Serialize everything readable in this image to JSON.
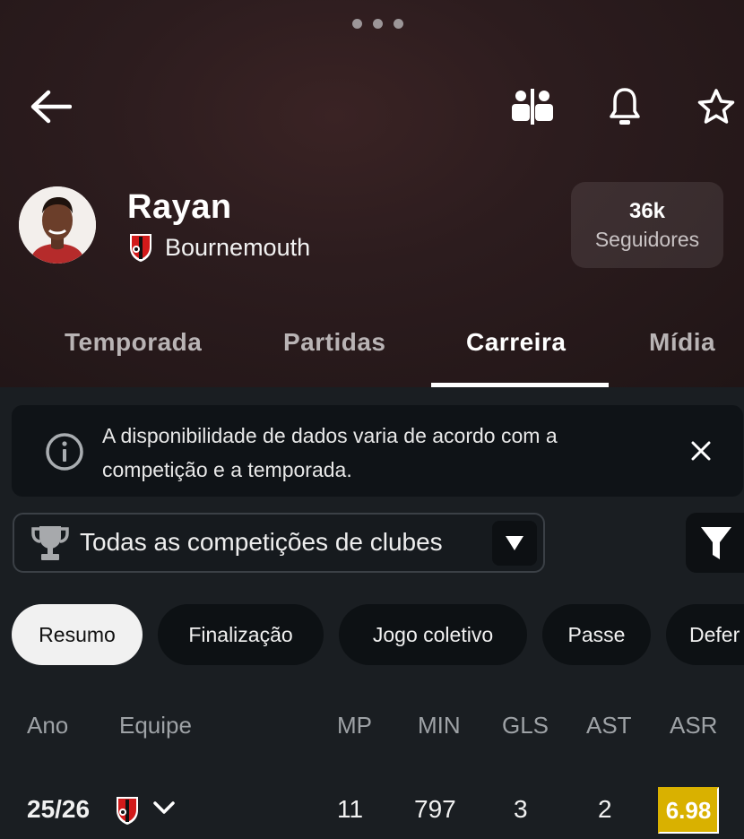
{
  "header": {
    "player_name": "Rayan",
    "club_name": "Bournemouth",
    "followers_count": "36k",
    "followers_label": "Seguidores"
  },
  "icons": {
    "back": "arrow-left-icon",
    "compare": "compare-players-icon",
    "notifications": "bell-icon",
    "favorite": "star-icon",
    "info": "info-icon",
    "close": "close-icon",
    "trophy": "trophy-icon",
    "dropdown": "caret-down-icon",
    "filter": "filter-icon",
    "expand": "chevron-down-icon"
  },
  "tabs": [
    {
      "label": "Temporada",
      "active": false
    },
    {
      "label": "Partidas",
      "active": false
    },
    {
      "label": "Carreira",
      "active": true
    },
    {
      "label": "Mídia",
      "active": false
    }
  ],
  "notice": {
    "text": "A disponibilidade de dados varia de acordo com a competição e a temporada."
  },
  "competition_select": {
    "value": "Todas as competições de clubes"
  },
  "chips": [
    {
      "label": "Resumo",
      "active": true
    },
    {
      "label": "Finalização",
      "active": false
    },
    {
      "label": "Jogo coletivo",
      "active": false
    },
    {
      "label": "Passe",
      "active": false
    },
    {
      "label": "Defer",
      "active": false
    }
  ],
  "table": {
    "headers": [
      "Ano",
      "Equipe",
      "MP",
      "MIN",
      "GLS",
      "AST",
      "ASR"
    ],
    "rows": [
      {
        "year": "25/26",
        "mp": "11",
        "min": "797",
        "gls": "3",
        "ast": "2",
        "asr": "6.98"
      }
    ]
  },
  "colors": {
    "accent_rating": "#d9b100",
    "background": "#1a1e22",
    "header_gradient": "#2c1c1e"
  }
}
